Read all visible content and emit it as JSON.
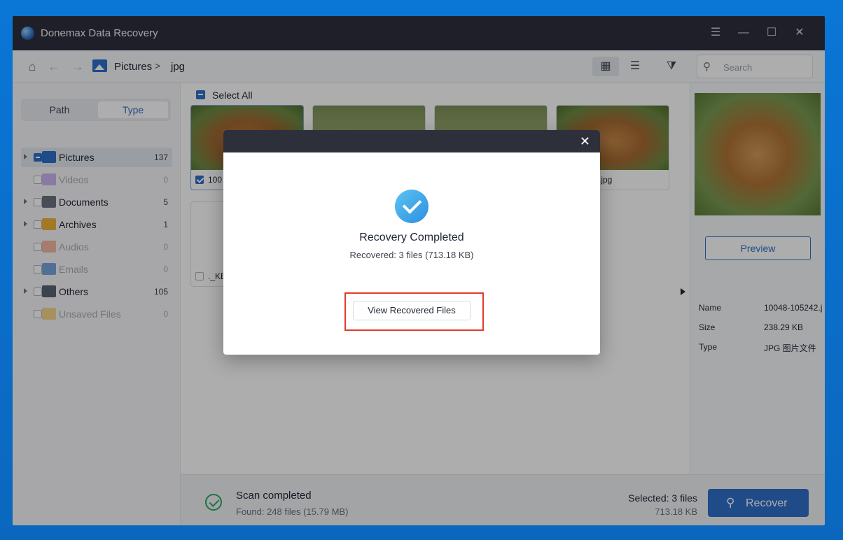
{
  "window": {
    "title": "Donemax Data Recovery",
    "controls": [
      "☰",
      "—",
      "☐",
      "✕"
    ]
  },
  "toolbar": {
    "breadcrumb": [
      "Pictures",
      "jpg"
    ],
    "breadcrumb_sep": ">",
    "search_placeholder": "Search"
  },
  "sidebar": {
    "tabs": [
      "Path",
      "Type"
    ],
    "active_tab": "Type",
    "items": [
      {
        "label": "Pictures",
        "count": "137",
        "icon": "picture-folder-icon",
        "color": "#2f6fc9"
      },
      {
        "label": "Videos",
        "count": "0",
        "icon": "video-folder-icon",
        "color": "#c9b6f0"
      },
      {
        "label": "Documents",
        "count": "5",
        "icon": "document-folder-icon",
        "color": "#6b7280"
      },
      {
        "label": "Archives",
        "count": "1",
        "icon": "archive-folder-icon",
        "color": "#f0b23a"
      },
      {
        "label": "Audios",
        "count": "0",
        "icon": "audio-folder-icon",
        "color": "#f3b9a0"
      },
      {
        "label": "Emails",
        "count": "0",
        "icon": "email-folder-icon",
        "color": "#7aa6dc"
      },
      {
        "label": "Others",
        "count": "105",
        "icon": "others-folder-icon",
        "color": "#5b6372"
      },
      {
        "label": "Unsaved Files",
        "count": "0",
        "icon": "unsaved-folder-icon",
        "color": "#f5d48a"
      }
    ]
  },
  "content": {
    "select_all": "Select All",
    "files": [
      {
        "name": "100",
        "checked": true
      },
      {
        "name": "",
        "checked": false
      },
      {
        "name": "",
        "checked": false
      },
      {
        "name": ".jpg",
        "checked": false
      },
      {
        "name": "._KE",
        "checked": false
      }
    ]
  },
  "preview": {
    "button": "Preview",
    "meta": [
      {
        "k": "Name",
        "v": "10048-105242.j"
      },
      {
        "k": "Size",
        "v": "238.29 KB"
      },
      {
        "k": "Type",
        "v": "JPG 图片文件"
      }
    ]
  },
  "status": {
    "title": "Scan completed",
    "found": "Found: 248 files (15.79 MB)",
    "selected": "Selected: 3 files",
    "selected_size": "713.18 KB",
    "recover": "Recover"
  },
  "dialog": {
    "close": "✕",
    "title": "Recovery Completed",
    "subtitle": "Recovered: 3 files (713.18 KB)",
    "button": "View Recovered Files"
  },
  "colors": {
    "accent": "#2f6fc9",
    "titlebar": "#2d2f3b",
    "success": "#2ea865",
    "highlight": "#e23b2a"
  }
}
